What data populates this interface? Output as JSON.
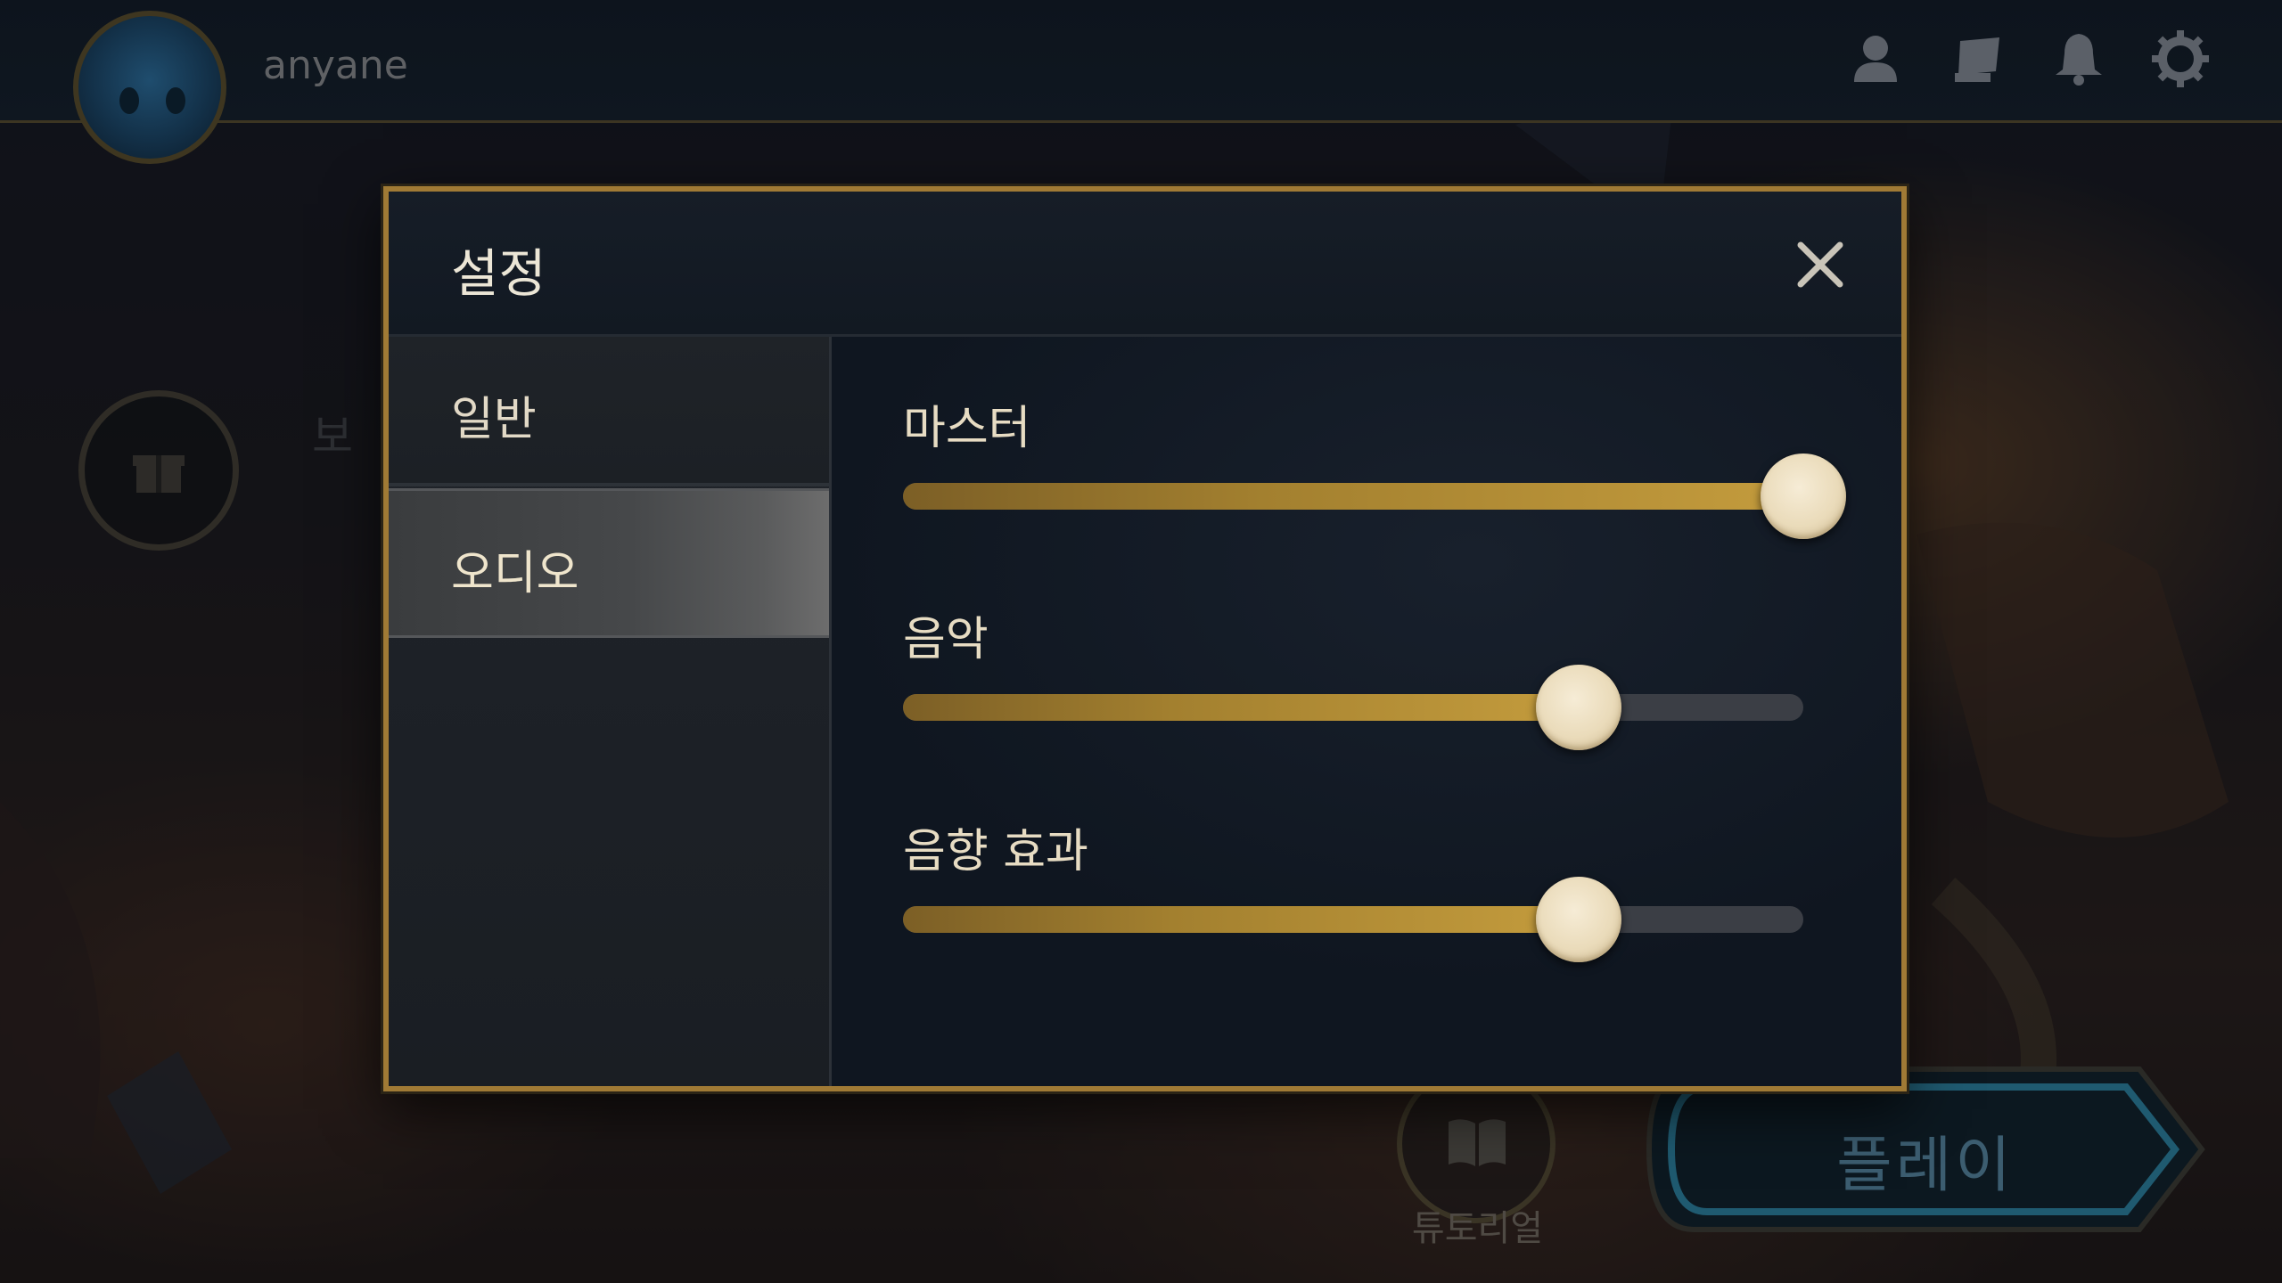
{
  "topbar": {
    "username": "anyane",
    "icons": [
      "profile-icon",
      "collection-icon",
      "bell-icon",
      "gear-icon"
    ]
  },
  "background": {
    "gift_label_partial": "보",
    "tutorial_label": "튜토리얼",
    "play_label": "플레이"
  },
  "dialog": {
    "title": "설정",
    "close_icon": "close-icon",
    "tabs": [
      {
        "label": "일반",
        "selected": false
      },
      {
        "label": "오디오",
        "selected": true
      }
    ],
    "sliders": [
      {
        "label": "마스터",
        "value": 1.0
      },
      {
        "label": "음악",
        "value": 0.75
      },
      {
        "label": "음향 효과",
        "value": 0.75
      }
    ]
  },
  "colors": {
    "dialog_border": "#a07a35",
    "slider_fill": "#c49c3d",
    "slider_track": "#3b3e45",
    "knob": "#eadbba"
  }
}
